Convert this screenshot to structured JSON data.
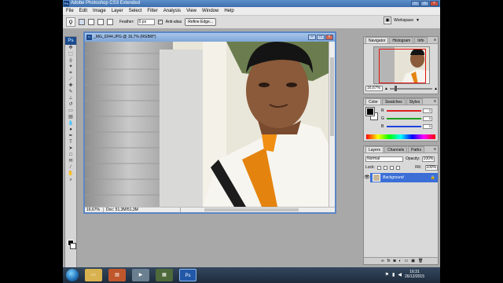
{
  "app": {
    "title": "Adobe Photoshop CS3 Extended",
    "logo": "Ps"
  },
  "menu": [
    "File",
    "Edit",
    "Image",
    "Layer",
    "Select",
    "Filter",
    "Analysis",
    "View",
    "Window",
    "Help"
  ],
  "options": {
    "feather_label": "Feather:",
    "feather_value": "0 px",
    "antialias_label": "Anti-alias",
    "refine_label": "Refine Edge...",
    "workspace_label": "Workspace"
  },
  "document": {
    "title": "_MG_0244.JPG @ 16,7% (RGB/8*)",
    "zoom": "16,67%",
    "info": "Doc: 51,3M/51,3M"
  },
  "navigator": {
    "tabs": [
      "Navigator",
      "Histogram",
      "Info"
    ],
    "zoom": "16,67%"
  },
  "color": {
    "tabs": [
      "Color",
      "Swatches",
      "Styles"
    ],
    "channels": [
      {
        "label": "R",
        "value": "0",
        "bar": "#e02020"
      },
      {
        "label": "G",
        "value": "0",
        "bar": "#20a020"
      },
      {
        "label": "B",
        "value": "0",
        "bar": "#2040e0"
      }
    ]
  },
  "layers": {
    "tabs": [
      "Layers",
      "Channels",
      "Paths"
    ],
    "blend_mode": "Normal",
    "opacity_label": "Opacity:",
    "opacity_value": "100%",
    "lock_label": "Lock:",
    "fill_label": "Fill:",
    "fill_value": "100%",
    "layer_name": "Background"
  },
  "taskbar": {
    "time": "16:31",
    "date": "26/12/2015"
  },
  "colors": {
    "selected_layer": "#3b6fd6",
    "navigator_box": "#e01010"
  }
}
